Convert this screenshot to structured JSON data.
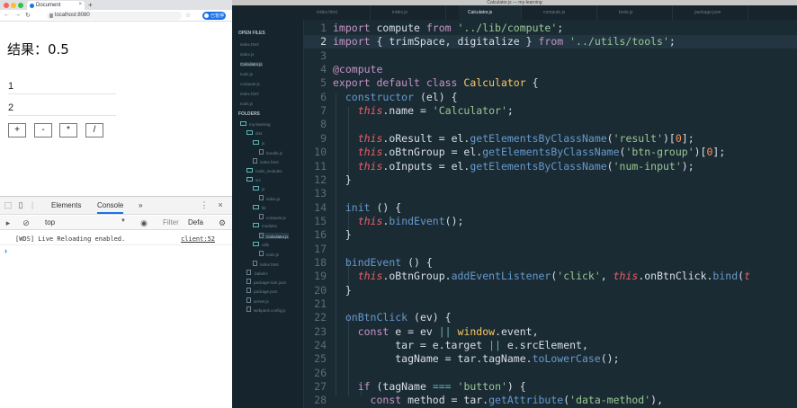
{
  "browser": {
    "tab_title": "Document",
    "new_tab_symbol": "+",
    "url": "localhost:8080",
    "profile_label": "已暂停",
    "page": {
      "result_label": "结果：0.5",
      "inputs": [
        "1",
        "2"
      ],
      "buttons": [
        "+",
        "-",
        "*",
        "/"
      ]
    }
  },
  "devtools": {
    "tabs": [
      "Elements",
      "Console"
    ],
    "more_symbol": "»",
    "context": "top",
    "filter_placeholder": "Filter",
    "levels": "Defa",
    "console_message": "[WDS] Live Reloading enabled.",
    "console_source": "client:52",
    "prompt": "›"
  },
  "editor": {
    "window_title": "Calculator.js — my-learning",
    "tabs": [
      "index.html",
      "index.js",
      "Calculator.js",
      "compute.js",
      "tools.js",
      "package.json"
    ],
    "active_tab_index": 2,
    "sidebar": {
      "open_files_heading": "OPEN FILES",
      "open_files": [
        "index.html",
        "index.js",
        "Calculator.js",
        "tools.js",
        "compute.js",
        "index.html",
        "tools.js"
      ],
      "folders_heading": "FOLDERS",
      "tree": [
        {
          "label": "my-learning",
          "kind": "folder",
          "indent": 0
        },
        {
          "label": "dist",
          "kind": "folder",
          "indent": 1
        },
        {
          "label": "js",
          "kind": "folder",
          "indent": 2
        },
        {
          "label": "bundle.js",
          "kind": "file",
          "indent": 3
        },
        {
          "label": "index.html",
          "kind": "file",
          "indent": 2
        },
        {
          "label": "node_modules",
          "kind": "folder",
          "indent": 1
        },
        {
          "label": "src",
          "kind": "folder",
          "indent": 1
        },
        {
          "label": "js",
          "kind": "folder",
          "indent": 2
        },
        {
          "label": "index.js",
          "kind": "file",
          "indent": 3
        },
        {
          "label": "lib",
          "kind": "folder",
          "indent": 2
        },
        {
          "label": "compute.js",
          "kind": "file",
          "indent": 3
        },
        {
          "label": "modules",
          "kind": "folder",
          "indent": 2
        },
        {
          "label": "Calculator.js",
          "kind": "file",
          "indent": 3,
          "active": true
        },
        {
          "label": "utils",
          "kind": "folder",
          "indent": 2
        },
        {
          "label": "tools.js",
          "kind": "file",
          "indent": 3
        },
        {
          "label": "index.html",
          "kind": "file",
          "indent": 2
        },
        {
          "label": ".babelrc",
          "kind": "file",
          "indent": 1
        },
        {
          "label": "package-lock.json",
          "kind": "file",
          "indent": 1
        },
        {
          "label": "package.json",
          "kind": "file",
          "indent": 1
        },
        {
          "label": "server.js",
          "kind": "file",
          "indent": 1
        },
        {
          "label": "webpack.config.js",
          "kind": "file",
          "indent": 1
        }
      ]
    },
    "current_line": 2,
    "code_lines": [
      [
        [
          "t-kw",
          "import"
        ],
        [
          "t-plain",
          " compute "
        ],
        [
          "t-kw",
          "from"
        ],
        [
          "t-plain",
          " "
        ],
        [
          "t-str",
          "'../lib/compute'"
        ],
        [
          "t-plain",
          ";"
        ]
      ],
      [
        [
          "t-kw",
          "import"
        ],
        [
          "t-plain",
          " { trimSpace, digitalize } "
        ],
        [
          "t-kw",
          "from"
        ],
        [
          "t-plain",
          " "
        ],
        [
          "t-str",
          "'../utils/tools'"
        ],
        [
          "t-plain",
          ";"
        ]
      ],
      [],
      [
        [
          "t-dec",
          "@compute"
        ]
      ],
      [
        [
          "t-kw",
          "export default class "
        ],
        [
          "t-cls",
          "Calculator"
        ],
        [
          "t-plain",
          " {"
        ]
      ],
      [
        [
          "t-plain",
          "  "
        ],
        [
          "t-fn",
          "constructor"
        ],
        [
          "t-plain",
          " (el) {"
        ]
      ],
      [
        [
          "t-plain",
          "    "
        ],
        [
          "t-this",
          "this"
        ],
        [
          "t-plain",
          ".name = "
        ],
        [
          "t-str",
          "'Calculator'"
        ],
        [
          "t-plain",
          ";"
        ]
      ],
      [],
      [
        [
          "t-plain",
          "    "
        ],
        [
          "t-this",
          "this"
        ],
        [
          "t-plain",
          ".oResult = el."
        ],
        [
          "t-fn",
          "getElementsByClassName"
        ],
        [
          "t-plain",
          "("
        ],
        [
          "t-str",
          "'result'"
        ],
        [
          "t-plain",
          ")["
        ],
        [
          "t-num",
          "0"
        ],
        [
          "t-plain",
          "];"
        ]
      ],
      [
        [
          "t-plain",
          "    "
        ],
        [
          "t-this",
          "this"
        ],
        [
          "t-plain",
          ".oBtnGroup = el."
        ],
        [
          "t-fn",
          "getElementsByClassName"
        ],
        [
          "t-plain",
          "("
        ],
        [
          "t-str",
          "'btn-group'"
        ],
        [
          "t-plain",
          ")["
        ],
        [
          "t-num",
          "0"
        ],
        [
          "t-plain",
          "];"
        ]
      ],
      [
        [
          "t-plain",
          "    "
        ],
        [
          "t-this",
          "this"
        ],
        [
          "t-plain",
          ".oInputs = el."
        ],
        [
          "t-fn",
          "getElementsByClassName"
        ],
        [
          "t-plain",
          "("
        ],
        [
          "t-str",
          "'num-input'"
        ],
        [
          "t-plain",
          ");"
        ]
      ],
      [
        [
          "t-plain",
          "  }"
        ]
      ],
      [],
      [
        [
          "t-plain",
          "  "
        ],
        [
          "t-fn",
          "init"
        ],
        [
          "t-plain",
          " () {"
        ]
      ],
      [
        [
          "t-plain",
          "    "
        ],
        [
          "t-this",
          "this"
        ],
        [
          "t-plain",
          "."
        ],
        [
          "t-fn",
          "bindEvent"
        ],
        [
          "t-plain",
          "();"
        ]
      ],
      [
        [
          "t-plain",
          "  }"
        ]
      ],
      [],
      [
        [
          "t-plain",
          "  "
        ],
        [
          "t-fn",
          "bindEvent"
        ],
        [
          "t-plain",
          " () {"
        ]
      ],
      [
        [
          "t-plain",
          "    "
        ],
        [
          "t-this",
          "this"
        ],
        [
          "t-plain",
          ".oBtnGroup."
        ],
        [
          "t-fn",
          "addEventListener"
        ],
        [
          "t-plain",
          "("
        ],
        [
          "t-str",
          "'click'"
        ],
        [
          "t-plain",
          ", "
        ],
        [
          "t-this",
          "this"
        ],
        [
          "t-plain",
          ".onBtnClick."
        ],
        [
          "t-fn",
          "bind"
        ],
        [
          "t-plain",
          "("
        ],
        [
          "t-this",
          "t"
        ]
      ],
      [
        [
          "t-plain",
          "  }"
        ]
      ],
      [],
      [
        [
          "t-plain",
          "  "
        ],
        [
          "t-fn",
          "onBtnClick"
        ],
        [
          "t-plain",
          " (ev) {"
        ]
      ],
      [
        [
          "t-plain",
          "    "
        ],
        [
          "t-kw",
          "const"
        ],
        [
          "t-plain",
          " e = ev "
        ],
        [
          "t-op",
          "||"
        ],
        [
          "t-plain",
          " "
        ],
        [
          "t-cls",
          "window"
        ],
        [
          "t-plain",
          ".event,"
        ]
      ],
      [
        [
          "t-plain",
          "          tar = e.target "
        ],
        [
          "t-op",
          "||"
        ],
        [
          "t-plain",
          " e.srcElement,"
        ]
      ],
      [
        [
          "t-plain",
          "          tagName = tar.tagName."
        ],
        [
          "t-fn",
          "toLowerCase"
        ],
        [
          "t-plain",
          "();"
        ]
      ],
      [],
      [
        [
          "t-plain",
          "    "
        ],
        [
          "t-kw",
          "if"
        ],
        [
          "t-plain",
          " (tagName "
        ],
        [
          "t-op",
          "==="
        ],
        [
          "t-plain",
          " "
        ],
        [
          "t-str",
          "'button'"
        ],
        [
          "t-plain",
          ") {"
        ]
      ],
      [
        [
          "t-plain",
          "      "
        ],
        [
          "t-kw",
          "const"
        ],
        [
          "t-plain",
          " method = tar."
        ],
        [
          "t-fn",
          "getAttribute"
        ],
        [
          "t-plain",
          "("
        ],
        [
          "t-str",
          "'data-method'"
        ],
        [
          "t-plain",
          "),"
        ]
      ]
    ],
    "line_numbers": [
      "1",
      "2",
      "3",
      "4",
      "5",
      "6",
      "7",
      "8",
      "9",
      "10",
      "11",
      "12",
      "13",
      "14",
      "15",
      "16",
      "17",
      "18",
      "19",
      "20",
      "21",
      "22",
      "23",
      "24",
      "25",
      "26",
      "27",
      "28"
    ]
  },
  "colors": {
    "editor_bg": "#1b2b34",
    "sidebar_bg": "#16252d",
    "keyword": "#c594c5",
    "string": "#99c794",
    "function": "#6699cc",
    "class": "#fac863",
    "this": "#ec5f67",
    "accent": "#1a73e8"
  }
}
